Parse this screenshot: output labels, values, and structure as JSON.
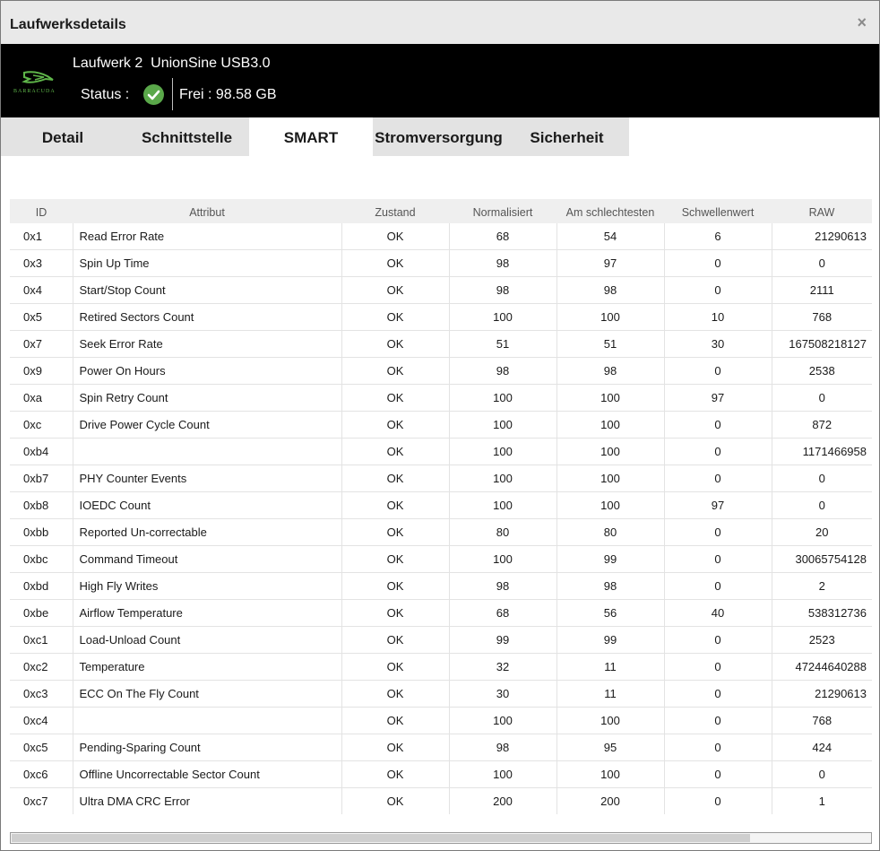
{
  "window": {
    "title": "Laufwerksdetails",
    "close_glyph": "×"
  },
  "header": {
    "logo_text": "BARRACUDA",
    "drive_name": "Laufwerk 2  UnionSine USB3.0",
    "status_label": "Status :",
    "status_icon": "check-circle-icon",
    "free_label": "Frei : 98.58 GB"
  },
  "colors": {
    "header_bg": "#000000",
    "status_ok": "#5aa84a",
    "tab_bg": "#e3e3e3",
    "tab_active_bg": "#ffffff"
  },
  "tabs": [
    "Detail",
    "Schnittstelle",
    "SMART",
    "Stromversorgung",
    "Sicherheit"
  ],
  "active_tab": "SMART",
  "table": {
    "columns": [
      "ID",
      "Attribut",
      "Zustand",
      "Normalisiert",
      "Am schlechtesten",
      "Schwellenwert",
      "RAW"
    ],
    "rows": [
      [
        "0x1",
        "Read Error Rate",
        "OK",
        "68",
        "54",
        "6",
        "21290613"
      ],
      [
        "0x3",
        "Spin Up Time",
        "OK",
        "98",
        "97",
        "0",
        "0"
      ],
      [
        "0x4",
        "Start/Stop Count",
        "OK",
        "98",
        "98",
        "0",
        "2111"
      ],
      [
        "0x5",
        "Retired Sectors Count",
        "OK",
        "100",
        "100",
        "10",
        "768"
      ],
      [
        "0x7",
        "Seek Error Rate",
        "OK",
        "51",
        "51",
        "30",
        "167508218127"
      ],
      [
        "0x9",
        "Power On Hours",
        "OK",
        "98",
        "98",
        "0",
        "2538"
      ],
      [
        "0xa",
        "Spin Retry Count",
        "OK",
        "100",
        "100",
        "97",
        "0"
      ],
      [
        "0xc",
        "Drive Power Cycle Count",
        "OK",
        "100",
        "100",
        "0",
        "872"
      ],
      [
        "0xb4",
        "",
        "OK",
        "100",
        "100",
        "0",
        "1171466958"
      ],
      [
        "0xb7",
        "PHY Counter Events",
        "OK",
        "100",
        "100",
        "0",
        "0"
      ],
      [
        "0xb8",
        "IOEDC Count",
        "OK",
        "100",
        "100",
        "97",
        "0"
      ],
      [
        "0xbb",
        "Reported Un-correctable",
        "OK",
        "80",
        "80",
        "0",
        "20"
      ],
      [
        "0xbc",
        "Command Timeout",
        "OK",
        "100",
        "99",
        "0",
        "30065754128"
      ],
      [
        "0xbd",
        "High Fly Writes",
        "OK",
        "98",
        "98",
        "0",
        "2"
      ],
      [
        "0xbe",
        "Airflow Temperature",
        "OK",
        "68",
        "56",
        "40",
        "538312736"
      ],
      [
        "0xc1",
        "Load-Unload Count",
        "OK",
        "99",
        "99",
        "0",
        "2523"
      ],
      [
        "0xc2",
        "Temperature",
        "OK",
        "32",
        "11",
        "0",
        "47244640288"
      ],
      [
        "0xc3",
        "ECC On The Fly Count",
        "OK",
        "30",
        "11",
        "0",
        "21290613"
      ],
      [
        "0xc4",
        "",
        "OK",
        "100",
        "100",
        "0",
        "768"
      ],
      [
        "0xc5",
        "Pending-Sparing Count",
        "OK",
        "98",
        "95",
        "0",
        "424"
      ],
      [
        "0xc6",
        "Offline Uncorrectable Sector Count",
        "OK",
        "100",
        "100",
        "0",
        "0"
      ],
      [
        "0xc7",
        "Ultra DMA CRC Error",
        "OK",
        "200",
        "200",
        "0",
        "1"
      ]
    ]
  },
  "scrollbar": {
    "horizontal_visible_fraction": 0.86
  }
}
